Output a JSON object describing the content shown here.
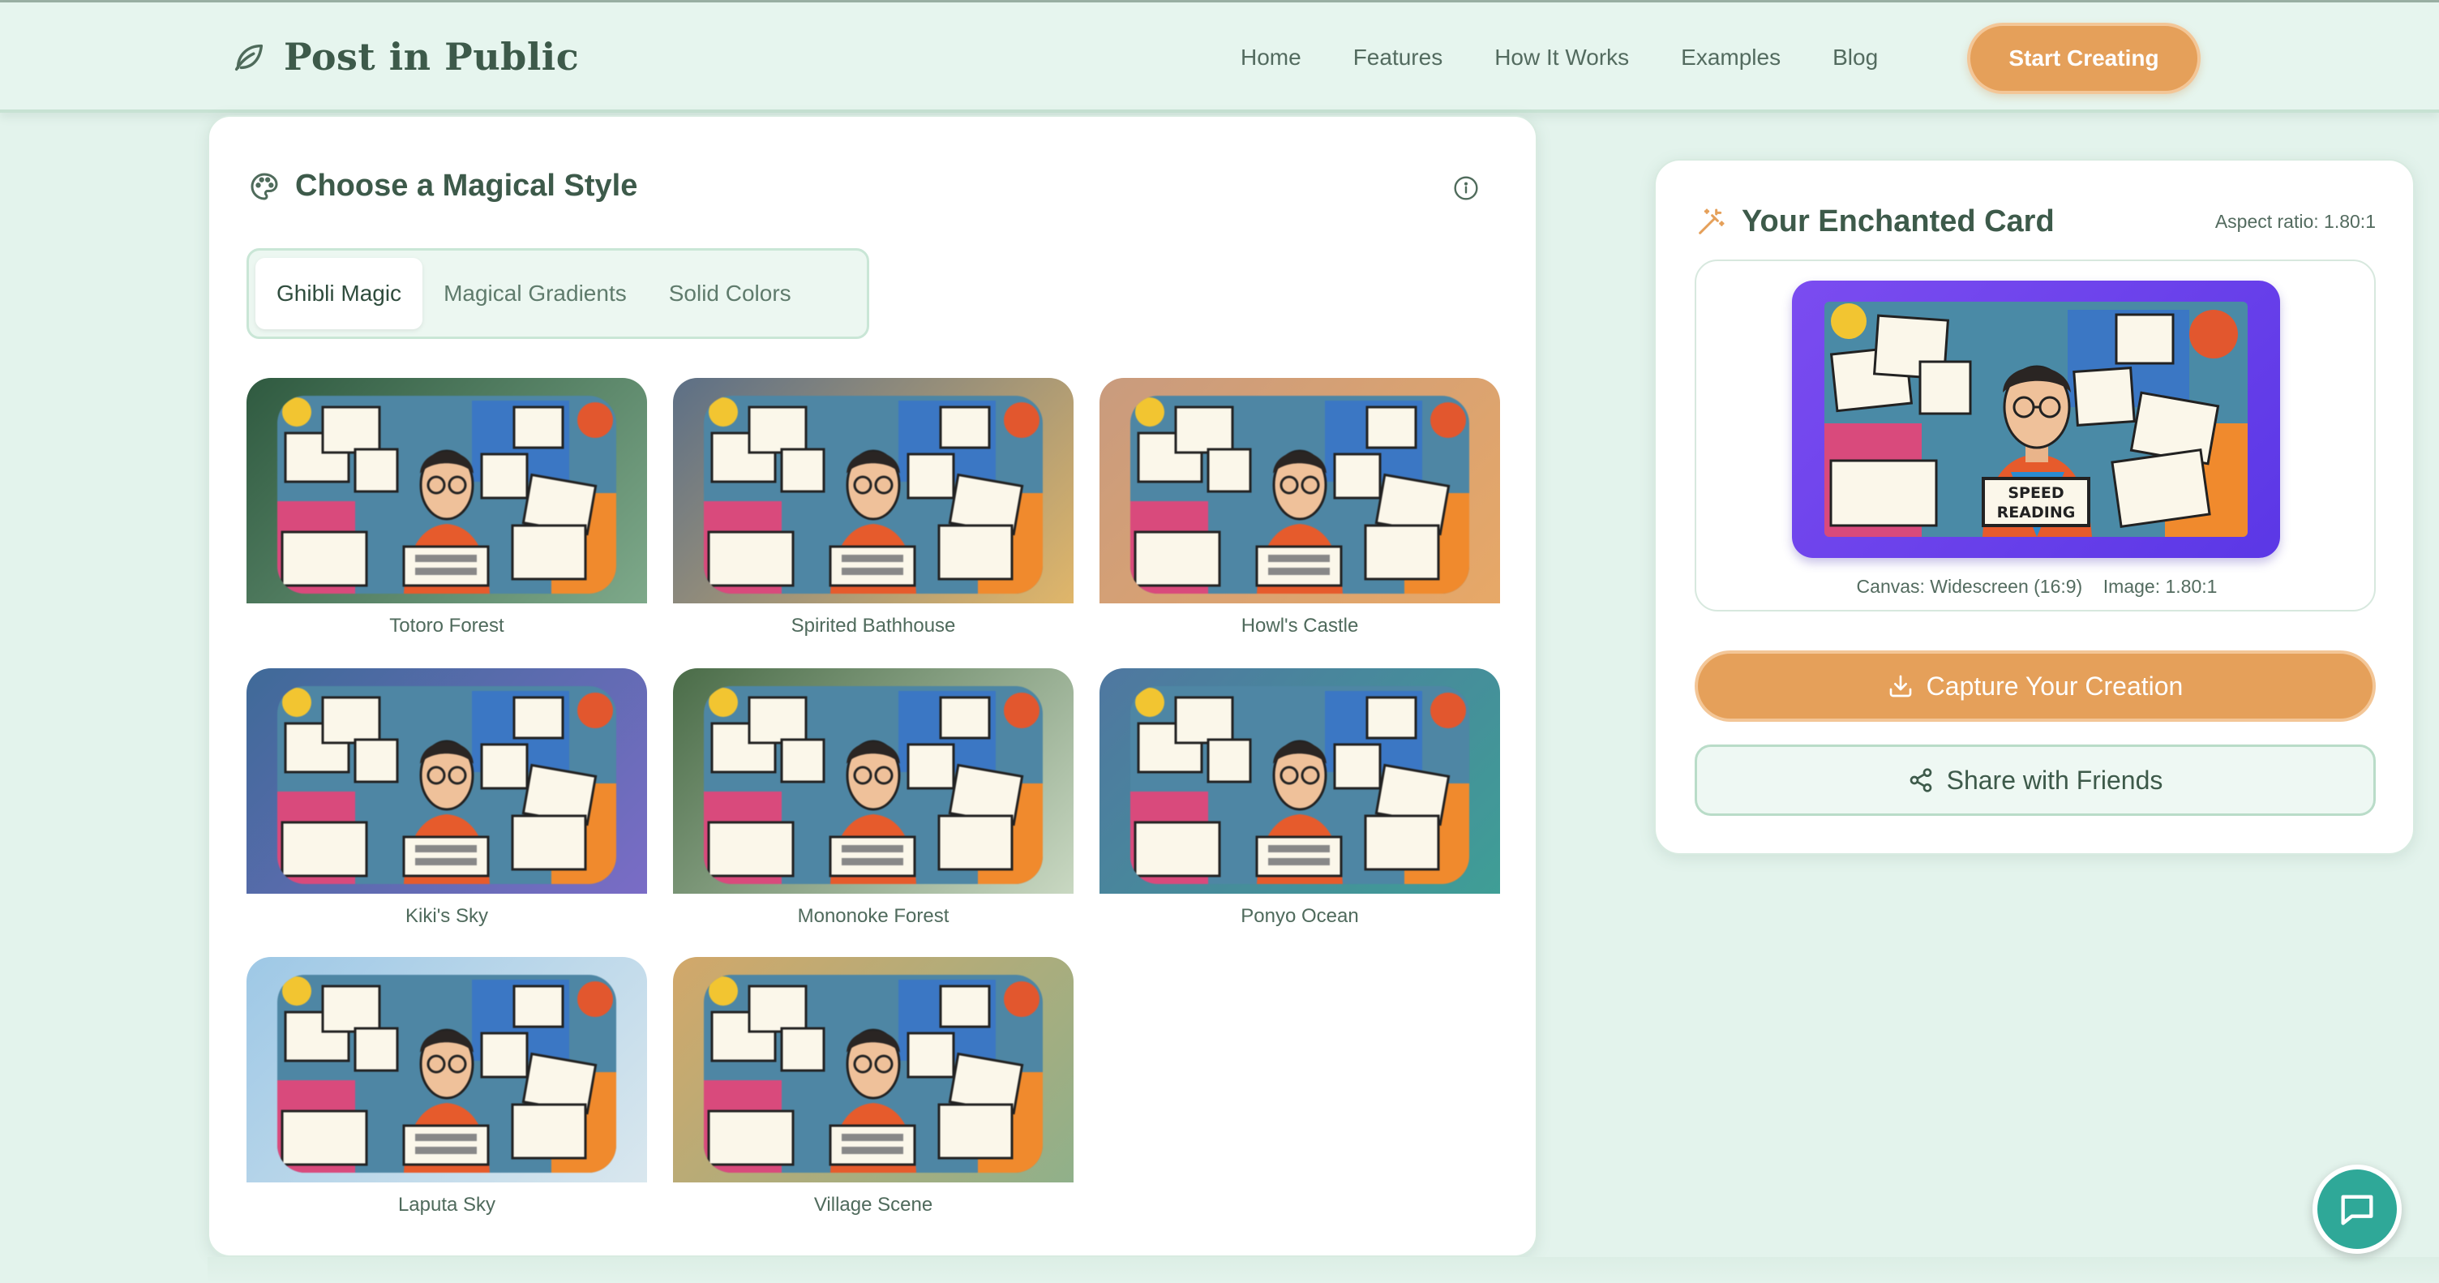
{
  "brand": {
    "name": "Post in Public",
    "icon": "leaf-icon"
  },
  "nav": {
    "links": [
      "Home",
      "Features",
      "How It Works",
      "Examples",
      "Blog"
    ],
    "cta": "Start Creating"
  },
  "style_panel": {
    "title": "Choose a Magical Style",
    "icon": "palette-icon",
    "info_icon": "info-icon",
    "tabs": [
      "Ghibli Magic",
      "Magical Gradients",
      "Solid Colors"
    ],
    "active_tab": "Ghibli Magic",
    "styles": [
      {
        "name": "Totoro Forest",
        "colors": [
          "#2f5a40",
          "#7ea98a"
        ]
      },
      {
        "name": "Spirited Bathhouse",
        "colors": [
          "#5c6f86",
          "#e0b66a"
        ]
      },
      {
        "name": "Howl's Castle",
        "colors": [
          "#c99b7e",
          "#e7a867"
        ]
      },
      {
        "name": "Kiki's Sky",
        "colors": [
          "#3f6a98",
          "#7a6cc6"
        ]
      },
      {
        "name": "Mononoke Forest",
        "colors": [
          "#4a6c48",
          "#c9d8c2"
        ]
      },
      {
        "name": "Ponyo Ocean",
        "colors": [
          "#4f77a0",
          "#3f9e96"
        ]
      },
      {
        "name": "Laputa Sky",
        "colors": [
          "#9ec8e6",
          "#d9e7ee"
        ]
      },
      {
        "name": "Village Scene",
        "colors": [
          "#d2a86a",
          "#90b08a"
        ]
      }
    ]
  },
  "preview_panel": {
    "title": "Your Enchanted Card",
    "icon": "wand-icon",
    "aspect_ratio": "Aspect ratio: 1.80:1",
    "canvas_info": "Canvas: Widescreen (16:9)    Image: 1.80:1",
    "card_colors": [
      "#7b4cf0",
      "#5b37e6"
    ],
    "capture_label": "Capture Your Creation",
    "share_label": "Share with Friends"
  },
  "chat": {
    "icon": "chat-bubble-icon"
  },
  "colors": {
    "accent": "#e5a05a",
    "background": "#e3f3ec",
    "text": "#3d5a4a",
    "chat": "#2fa898"
  }
}
